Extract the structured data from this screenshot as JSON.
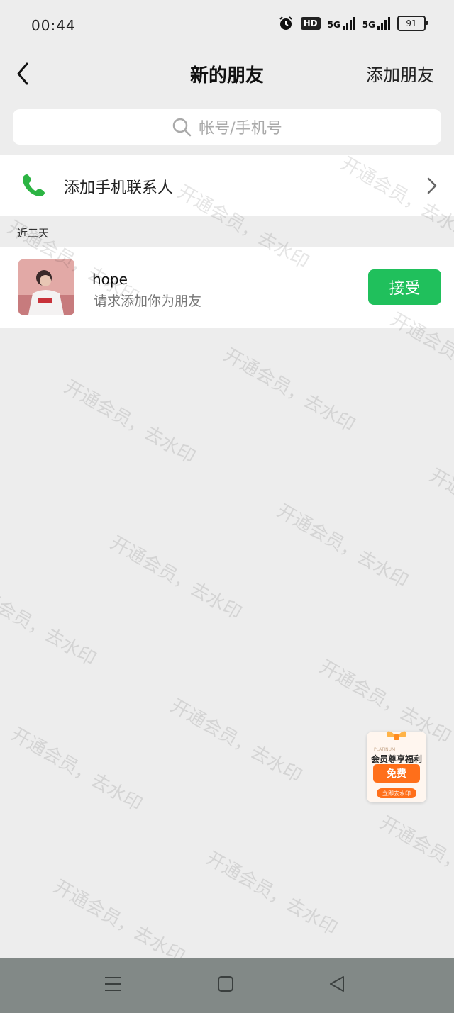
{
  "status_bar": {
    "time": "00:44",
    "hd_label": "HD",
    "network_1": "5G",
    "network_2": "5G",
    "battery": "91"
  },
  "nav": {
    "title": "新的朋友",
    "right_action": "添加朋友"
  },
  "search": {
    "placeholder": "帐号/手机号"
  },
  "contacts_entry": {
    "label": "添加手机联系人"
  },
  "section": {
    "label": "近三天"
  },
  "friend_requests": [
    {
      "name": "hope",
      "message": "请求添加你为朋友",
      "action": "接受"
    }
  ],
  "watermark_text": "开通会员，去水印",
  "promo": {
    "title": "会员尊享福利",
    "badge": "免费",
    "cta": "立即去水印",
    "small_text": "PLATINUM"
  },
  "colors": {
    "accept_green": "#20c05c",
    "phone_icon_green": "#2cb443",
    "background": "#ededed",
    "promo_orange": "#ff6f1a",
    "bottom_bar": "#828987"
  }
}
